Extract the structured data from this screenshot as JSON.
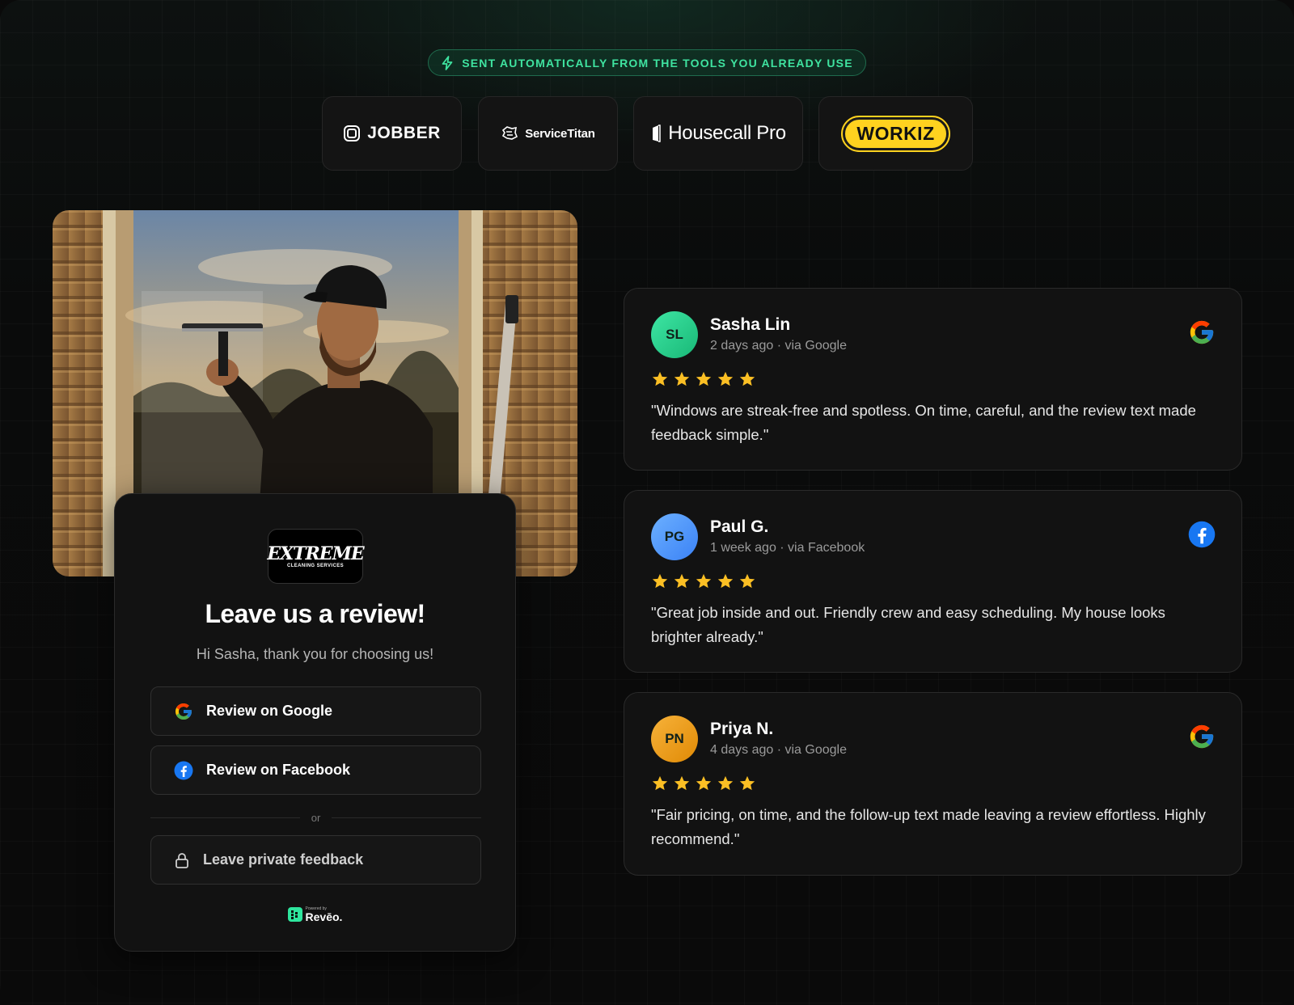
{
  "badge": {
    "text": "SENT AUTOMATICALLY FROM THE TOOLS YOU ALREADY USE",
    "icon": "bolt-icon"
  },
  "integrations": [
    {
      "name": "JOBBER"
    },
    {
      "name": "ServiceTitan"
    },
    {
      "name": "Housecall Pro"
    },
    {
      "name": "WORKIZ"
    }
  ],
  "review_card": {
    "brand_main": "EXTREME",
    "brand_sub": "CLEANING SERVICES",
    "title": "Leave us a review!",
    "subtitle": "Hi Sasha, thank you for choosing us!",
    "google_button": "Review on Google",
    "facebook_button": "Review on Facebook",
    "divider_text": "or",
    "private_button": "Leave private feedback",
    "powered_by": "Powered by",
    "powered_name": "Revēo."
  },
  "testimonials": [
    {
      "initials": "SL",
      "name": "Sasha Lin",
      "meta": "2 days ago · via Google",
      "source": "google",
      "rating": 5,
      "text": "\"Windows are streak-free and spotless. On time, careful, and the review text made feedback simple.\""
    },
    {
      "initials": "PG",
      "name": "Paul G.",
      "meta": "1 week ago · via Facebook",
      "source": "facebook",
      "rating": 5,
      "text": "\"Great job inside and out. Friendly crew and easy scheduling. My house looks brighter already.\""
    },
    {
      "initials": "PN",
      "name": "Priya N.",
      "meta": "4 days ago · via Google",
      "source": "google",
      "rating": 5,
      "text": "\"Fair pricing, on time, and the follow-up text made leaving a review effortless. Highly recommend.\""
    }
  ],
  "colors": {
    "accent_green": "#3fe3a0",
    "star": "#fbbf24",
    "facebook": "#1877f2",
    "avatar_sl": "#34d399",
    "avatar_pg": "#60a5fa",
    "avatar_pn": "#f59e0b"
  }
}
